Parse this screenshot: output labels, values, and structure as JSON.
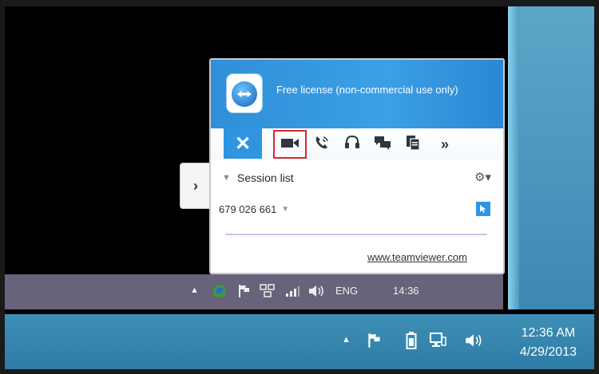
{
  "remote_taskbar": {
    "language": "ENG",
    "time": "14:36"
  },
  "local_taskbar": {
    "time": "12:36 AM",
    "date": "4/29/2013"
  },
  "teamviewer_panel": {
    "license_text": "Free license (non-commercial use only)",
    "close_label": "✕",
    "more_label": "»",
    "session_list_label": "Session list",
    "session_id": "679 026 661",
    "website_link": "www.teamviewer.com",
    "toolbar_icons": [
      "video-icon",
      "voip-icon",
      "headset-icon",
      "chat-icon",
      "file-transfer-icon"
    ],
    "highlighted_tool": "video-icon",
    "highlight_color": "#d8282f",
    "accent_color": "#2f95e0"
  }
}
